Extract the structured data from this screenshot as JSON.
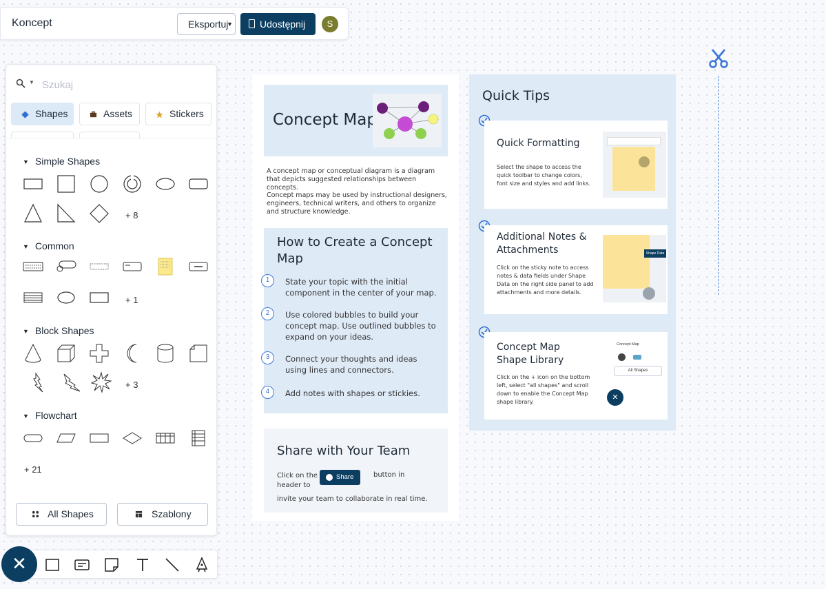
{
  "header": {
    "title": "Koncept",
    "export_label": "Eksportuj",
    "share_label": "Udostępnij",
    "avatar_initial": "S"
  },
  "panel": {
    "search_placeholder": "Szukaj",
    "tabs": [
      {
        "label": "Shapes",
        "icon": "diamond-icon"
      },
      {
        "label": "Assets",
        "icon": "briefcase-icon"
      },
      {
        "label": "Stickers",
        "icon": "star-icon"
      }
    ],
    "sections": {
      "simple": {
        "title": "Simple Shapes",
        "more": "+ 8"
      },
      "common": {
        "title": "Common",
        "more": "+ 1"
      },
      "block": {
        "title": "Block Shapes",
        "more": "+ 3"
      },
      "flowchart": {
        "title": "Flowchart",
        "more": "+ 21"
      }
    },
    "all_shapes_label": "All Shapes",
    "templates_label": "Szablony"
  },
  "canvas": {
    "concept_map_title": "Concept Map",
    "desc1": "A concept map or conceptual diagram is a diagram that depicts suggested relationships between concepts.",
    "desc2": "Concept maps may be used by instructional designers, engineers, technical writers, and others to organize and structure knowledge.",
    "howto_title": "How to Create a Concept Map",
    "steps": [
      {
        "num": "1",
        "text": "State your topic with the initial component in the center of your map."
      },
      {
        "num": "2",
        "text": "Use colored bubbles to build your concept map. Use outlined bubbles to expand on your ideas."
      },
      {
        "num": "3",
        "text": "Connect your thoughts and ideas using lines and connectors."
      },
      {
        "num": "4",
        "text": "Add notes with shapes or stickies."
      }
    ],
    "share_title": "Share with Your Team",
    "share_pre": "Click on the header to",
    "share_chip": "Share",
    "share_post": "button in",
    "share_tail": "invite your team to collaborate in real time.",
    "tips_title": "Quick Tips",
    "tips": [
      {
        "title": "Quick Formatting",
        "body": "Select the shape to access the quick toolbar to change colors, font size and styles and add links."
      },
      {
        "title": "Additional Notes & Attachments",
        "body": "Click on the sticky note to access notes & data fields under Shape Data on the right side panel to add attachments and more details.",
        "img_label": "Shape Data"
      },
      {
        "title": "Concept Map Shape Library",
        "body": "Click on the + icon on the bottom left, select \"all shapes\" and scroll down to enable the Concept Map shape library.",
        "img_label1": "Concept Map",
        "img_label2": "All Shapes"
      }
    ]
  },
  "colors": {
    "brand": "#0c3e61",
    "accent": "#3d78d8",
    "card_blue": "#dfeaf7"
  }
}
